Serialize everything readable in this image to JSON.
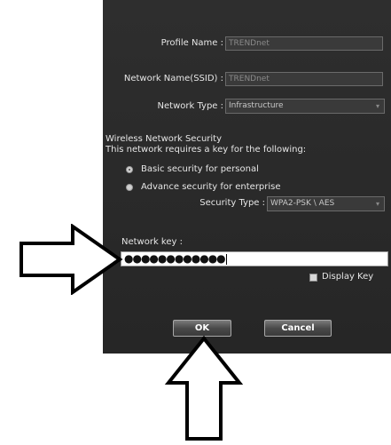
{
  "profile": {
    "profile_name_label": "Profile Name :",
    "profile_name_value": "TRENDnet",
    "ssid_label": "Network Name(SSID) :",
    "ssid_value": "TRENDnet",
    "network_type_label": "Network Type :",
    "network_type_value": "Infrastructure"
  },
  "security": {
    "heading": "Wireless Network Security",
    "description": "This network requires  a key for the following:",
    "options": [
      {
        "label": "Basic security for personal",
        "selected": true
      },
      {
        "label": "Advance security for enterprise",
        "selected": false
      }
    ],
    "security_type_label": "Security Type :",
    "security_type_value": "WPA2-PSK \\ AES"
  },
  "key": {
    "label": "Network key :",
    "value": "●●●●●●●●●●●●",
    "display_key_label": "Display Key",
    "display_key_checked": false
  },
  "buttons": {
    "ok_label": "OK",
    "cancel_label": "Cancel"
  },
  "icons": {
    "dropdown": "chevron-down-icon",
    "pointer_right": "arrow-right-icon",
    "pointer_up": "arrow-up-icon"
  },
  "colors": {
    "dialog_bg": "#2b2b2b",
    "label_text": "#e6e6e6",
    "disabled_text": "#8a8a8a"
  }
}
